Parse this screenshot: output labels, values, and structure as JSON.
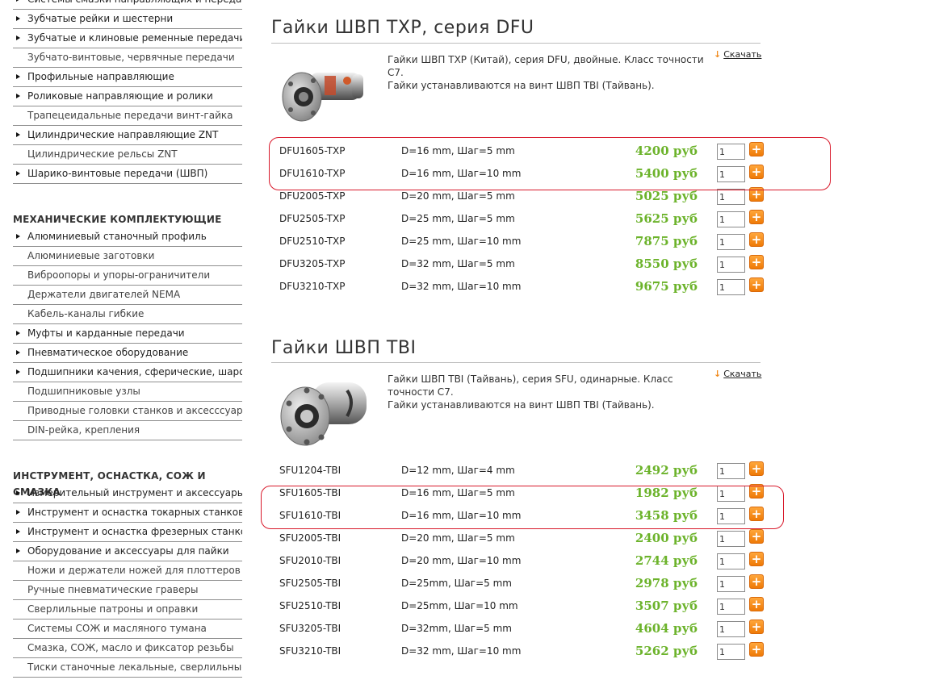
{
  "sidebar": {
    "items_a": [
      {
        "label": "Системы смазки направляющих и передач",
        "sub": true
      },
      {
        "label": "Зубчатые рейки и шестерни",
        "sub": true
      },
      {
        "label": "Зубчатые и клиновые ременные передачи",
        "sub": true
      },
      {
        "label": "Зубчато-винтовые, червячные передачи",
        "sub": false
      },
      {
        "label": "Профильные направляющие",
        "sub": true
      },
      {
        "label": "Роликовые направляющие и ролики",
        "sub": true
      },
      {
        "label": "Трапецеидальные передачи винт-гайка",
        "sub": false
      },
      {
        "label": "Цилиндрические направляющие ZNT",
        "sub": true
      },
      {
        "label": "Цилиндрические рельсы ZNT",
        "sub": false
      },
      {
        "label": "Шарико-винтовые передачи (ШВП)",
        "sub": true
      }
    ],
    "section_b": "МЕХАНИЧЕСКИЕ КОМПЛЕКТУЮЩИЕ",
    "items_b": [
      {
        "label": "Алюминиевый станочный профиль",
        "sub": true
      },
      {
        "label": "Алюминиевые заготовки",
        "sub": false
      },
      {
        "label": "Виброопоры и упоры-ограничители",
        "sub": false
      },
      {
        "label": "Держатели двигателей NEMA",
        "sub": false
      },
      {
        "label": "Кабель-каналы гибкие",
        "sub": false
      },
      {
        "label": "Муфты и карданные передачи",
        "sub": true
      },
      {
        "label": "Пневматическое оборудование",
        "sub": true
      },
      {
        "label": "Подшипники качения, сферические, шаровые",
        "sub": true
      },
      {
        "label": "Подшипниковые узлы",
        "sub": false
      },
      {
        "label": "Приводные головки станков и аксесссуары",
        "sub": false
      },
      {
        "label": "DIN-рейка, крепления",
        "sub": false
      }
    ],
    "section_c": "ИНСТРУМЕНТ, ОСНАСТКА, СОЖ И СМАЗКА",
    "items_c": [
      {
        "label": "Измерительный инструмент и аксессуары",
        "sub": true
      },
      {
        "label": "Инструмент и оснастка токарных станков",
        "sub": true
      },
      {
        "label": "Инструмент и оснастка фрезерных станков",
        "sub": true
      },
      {
        "label": "Оборудование и аксессуары для пайки",
        "sub": true
      },
      {
        "label": "Ножи и держатели ножей для плоттеров",
        "sub": false
      },
      {
        "label": "Ручные пневматические граверы",
        "sub": false
      },
      {
        "label": "Сверлильные патроны и оправки",
        "sub": false
      },
      {
        "label": "Системы СОЖ и масляного тумана",
        "sub": false
      },
      {
        "label": "Смазка, СОЖ, масло и фиксатор резьбы",
        "sub": false
      },
      {
        "label": "Тиски станочные лекальные, сверлильные",
        "sub": false
      }
    ]
  },
  "sections": [
    {
      "title": "Гайки ШВП TXP, серия DFU",
      "desc_line1": "Гайки ШВП TXP (Китай), серия DFU, двойные. Класс точности С7.",
      "desc_line2": "Гайки устанавливаются на винт ШВП TBI (Тайвань).",
      "download": "Скачать",
      "image": "ball-screw-nut-double",
      "rows": [
        {
          "code": "DFU1605-TXP",
          "spec": "D=16 mm, Шаг=5 mm",
          "price": "4200 руб",
          "qty": "1"
        },
        {
          "code": "DFU1610-TXP",
          "spec": "D=16 mm, Шаг=10 mm",
          "price": "5400 руб",
          "qty": "1"
        },
        {
          "code": "DFU2005-TXP",
          "spec": "D=20 mm, Шаг=5 mm",
          "price": "5025 руб",
          "qty": "1"
        },
        {
          "code": "DFU2505-TXP",
          "spec": "D=25 mm, Шаг=5 mm",
          "price": "5625 руб",
          "qty": "1"
        },
        {
          "code": "DFU2510-TXP",
          "spec": "D=25 mm, Шаг=10 mm",
          "price": "7875 руб",
          "qty": "1"
        },
        {
          "code": "DFU3205-TXP",
          "spec": "D=32 mm, Шаг=5 mm",
          "price": "8550 руб",
          "qty": "1"
        },
        {
          "code": "DFU3210-TXP",
          "spec": "D=32 mm, Шаг=10 mm",
          "price": "9675 руб",
          "qty": "1"
        }
      ]
    },
    {
      "title": "Гайки ШВП TBI",
      "desc_line1": "Гайки ШВП TBI (Тайвань), серия SFU, одинарные. Класс точности С7.",
      "desc_line2": "Гайки устанавливаются на винт ШВП TBI (Тайвань).",
      "download": "Скачать",
      "image": "ball-screw-nut-single",
      "rows": [
        {
          "code": "SFU1204-TBI",
          "spec": "D=12 mm, Шаг=4 mm",
          "price": "2492 руб",
          "qty": "1"
        },
        {
          "code": "SFU1605-TBI",
          "spec": "D=16 mm, Шаг=5 mm",
          "price": "1982 руб",
          "qty": "1"
        },
        {
          "code": "SFU1610-TBI",
          "spec": "D=16 mm, Шаг=10 mm",
          "price": "3458 руб",
          "qty": "1"
        },
        {
          "code": "SFU2005-TBI",
          "spec": "D=20 mm, Шаг=5 mm",
          "price": "2400 руб",
          "qty": "1"
        },
        {
          "code": "SFU2010-TBI",
          "spec": "D=20 mm, Шаг=10 mm",
          "price": "2744 руб",
          "qty": "1"
        },
        {
          "code": "SFU2505-TBI",
          "spec": "D=25mm, Шаг=5 mm",
          "price": "2978 руб",
          "qty": "1"
        },
        {
          "code": "SFU2510-TBI",
          "spec": "D=25mm, Шаг=10 mm",
          "price": "3507 руб",
          "qty": "1"
        },
        {
          "code": "SFU3205-TBI",
          "spec": "D=32mm, Шаг=5 mm",
          "price": "4604 руб",
          "qty": "1"
        },
        {
          "code": "SFU3210-TBI",
          "spec": "D=32 mm, Шаг=10 mm",
          "price": "5262 руб",
          "qty": "1"
        }
      ]
    }
  ],
  "colors": {
    "price": "#6cb32b",
    "accent": "#f08a1c",
    "highlight": "#d8182a"
  },
  "add_icon": "+"
}
